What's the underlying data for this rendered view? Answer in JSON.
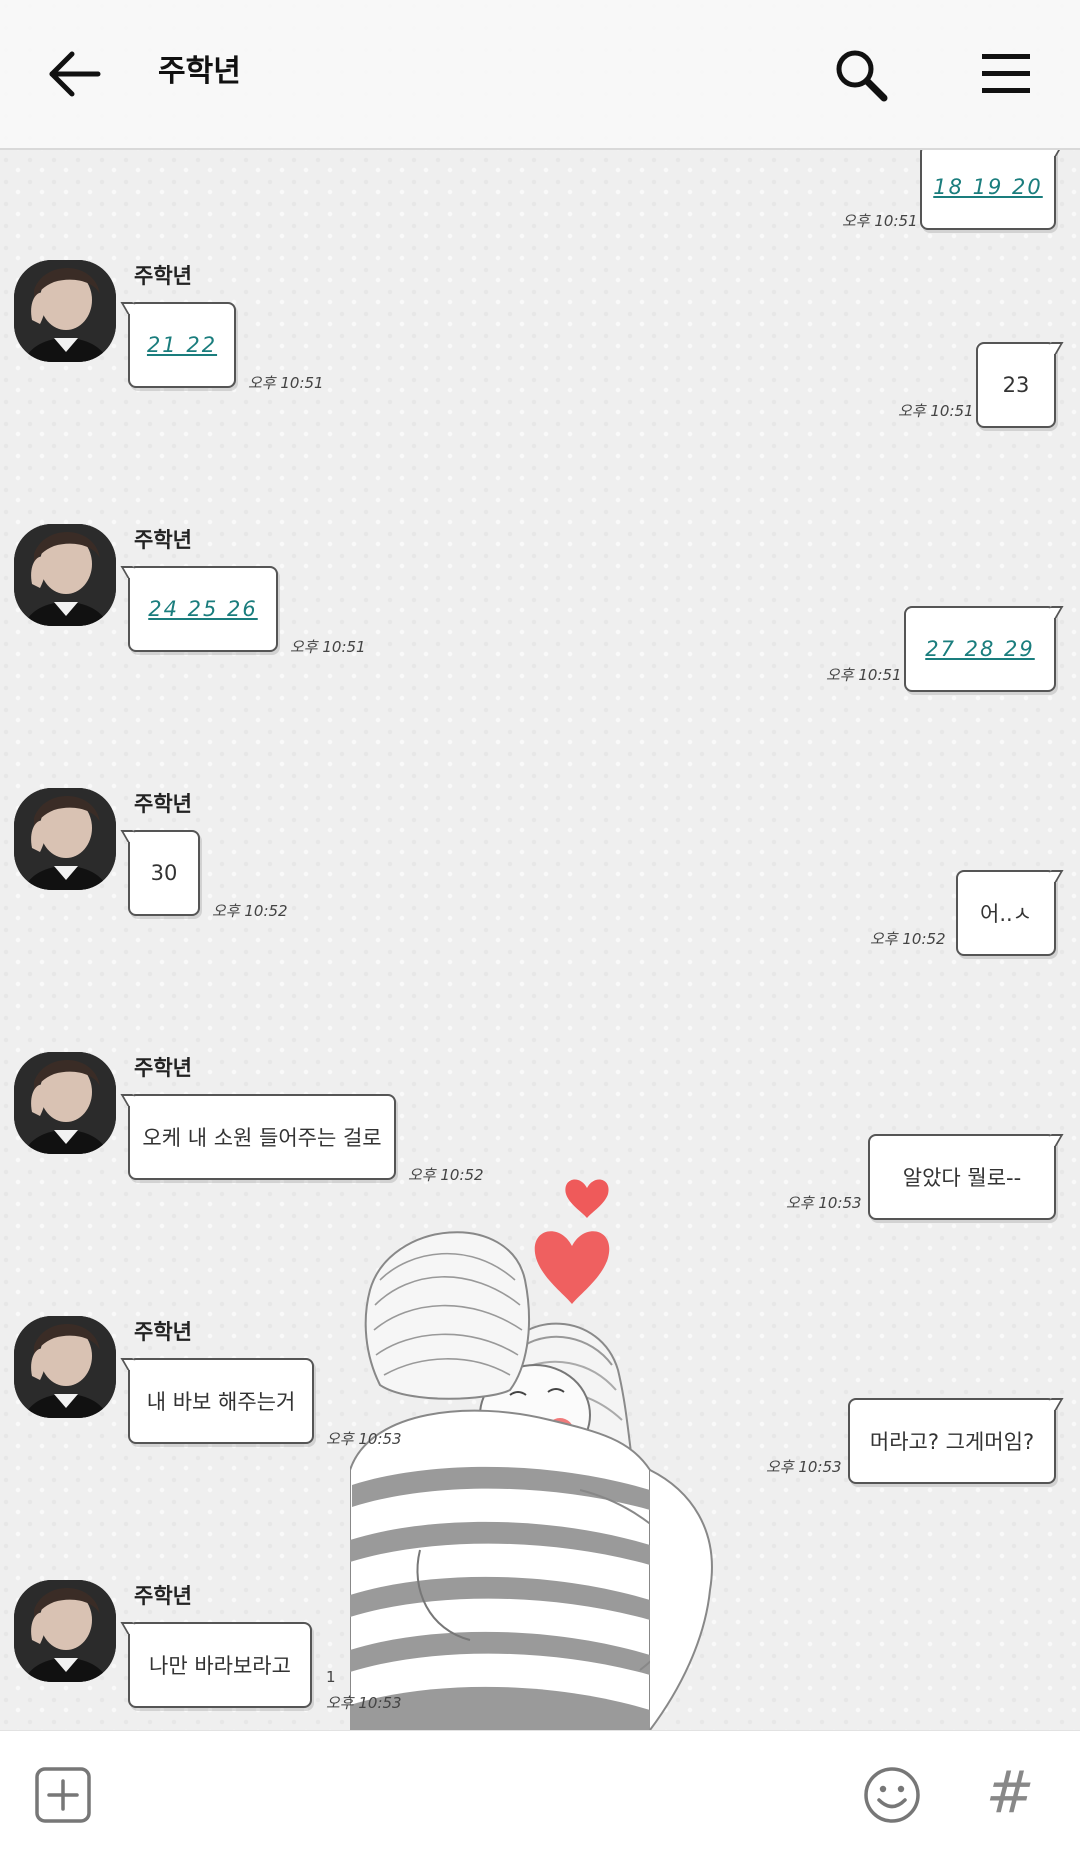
{
  "header": {
    "title": "주학년"
  },
  "messages": [
    {
      "dir": "out",
      "text": "18 19 20",
      "link": true,
      "time": "오후 10:51"
    },
    {
      "dir": "in",
      "sender": "주학년",
      "text": "21 22",
      "link": true,
      "time": "오후 10:51"
    },
    {
      "dir": "out",
      "text": "23",
      "link": false,
      "time": "오후 10:51"
    },
    {
      "dir": "in",
      "sender": "주학년",
      "text": "24 25 26",
      "link": true,
      "time": "오후 10:51"
    },
    {
      "dir": "out",
      "text": "27 28 29",
      "link": true,
      "time": "오후 10:51"
    },
    {
      "dir": "in",
      "sender": "주학년",
      "text": "30",
      "link": false,
      "time": "오후 10:52"
    },
    {
      "dir": "out",
      "text": "어..ㅅ",
      "link": false,
      "time": "오후 10:52"
    },
    {
      "dir": "in",
      "sender": "주학년",
      "text": "오케 내 소원 들어주는 걸로",
      "link": false,
      "time": "오후 10:52"
    },
    {
      "dir": "out",
      "text": "알았다 뭘로--",
      "link": false,
      "time": "오후 10:53"
    },
    {
      "dir": "in",
      "sender": "주학년",
      "text": "내 바보 해주는거",
      "link": false,
      "time": "오후 10:53"
    },
    {
      "dir": "out",
      "text": "머라고? 그게머임?",
      "link": false,
      "time": "오후 10:53"
    },
    {
      "dir": "in",
      "sender": "주학년",
      "text": "나만 바라보라고",
      "link": false,
      "time": "오후 10:53",
      "unread": "1"
    }
  ],
  "colors": {
    "link": "#1a7d7d",
    "heart": "#ef5a5a",
    "bubble_border": "#555555",
    "background": "#efefef"
  },
  "icons": {
    "back": "arrow-left-icon",
    "search": "search-icon",
    "menu": "hamburger-menu-icon",
    "add": "plus-square-icon",
    "emoji": "smiley-face-icon",
    "hashtag": "hashtag-icon"
  },
  "bottom": {
    "hash": "#"
  }
}
